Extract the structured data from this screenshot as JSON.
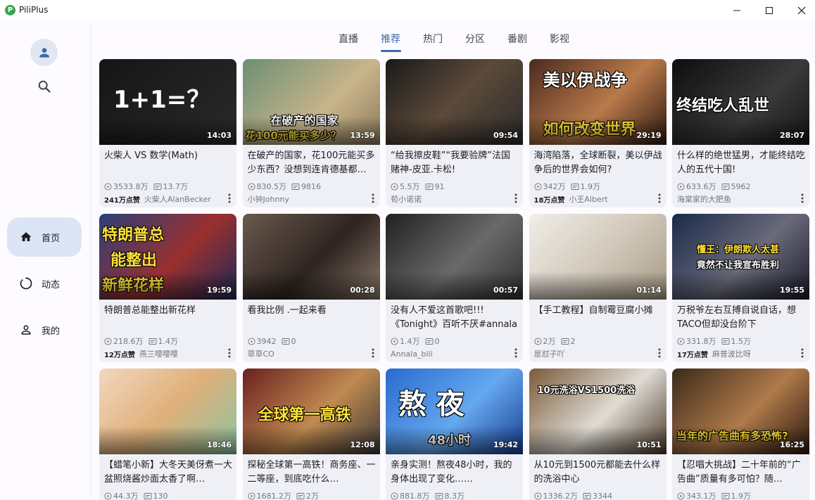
{
  "window": {
    "title": "PiliPlus",
    "logo_letter": "P"
  },
  "sidebar": {
    "items": [
      {
        "label": "首页",
        "icon": "home-icon",
        "active": true
      },
      {
        "label": "动态",
        "icon": "dynamic-icon",
        "active": false
      },
      {
        "label": "我的",
        "icon": "person-icon",
        "active": false
      }
    ]
  },
  "tabs": [
    {
      "label": "直播",
      "active": false
    },
    {
      "label": "推荐",
      "active": true
    },
    {
      "label": "热门",
      "active": false
    },
    {
      "label": "分区",
      "active": false
    },
    {
      "label": "番剧",
      "active": false
    },
    {
      "label": "影视",
      "active": false
    }
  ],
  "colors": {
    "accent": "#3a6ab0",
    "card_bg": "#eff0f6",
    "active_nav": "#dce5f5"
  },
  "videos": [
    {
      "title": "火柴人 VS 数学(Math)",
      "duration": "14:03",
      "views": "3533.8万",
      "danmaku": "13.7万",
      "likes": "241万点赞",
      "author": "火柴人AlanBecker",
      "overlay": "1+1=？"
    },
    {
      "title": "在破产的国家，花100元能买多少东西？没想到连肯德基都…",
      "duration": "13:59",
      "views": "830.5万",
      "danmaku": "9816",
      "likes": "",
      "author": "小钟Johnny",
      "overlay": "在破产的国家|花100元能买多少？"
    },
    {
      "title": "“给我擦皮鞋”“我要验牌”法国赌神-皮亚.卡松!",
      "duration": "09:54",
      "views": "5.5万",
      "danmaku": "91",
      "likes": "",
      "author": "荀小诺诺",
      "overlay": ""
    },
    {
      "title": "海湾陷落，全球断裂，美以伊战争后的世界会如何?",
      "duration": "29:19",
      "views": "342万",
      "danmaku": "1.9万",
      "likes": "18万点赞",
      "author": "小王Albert",
      "overlay": "美以伊战争|如何改变世界"
    },
    {
      "title": "什么样的绝世猛男，才能终结吃人的五代十国!",
      "duration": "28:07",
      "views": "633.6万",
      "danmaku": "5962",
      "likes": "",
      "author": "海棠家的大肥鱼",
      "overlay": "终结吃人乱世"
    },
    {
      "title": "特朗普总能整出新花样",
      "duration": "19:59",
      "views": "218.6万",
      "danmaku": "1.4万",
      "likes": "12万点赞",
      "author": "燕三嘤嘤嘤",
      "overlay": "特朗普总|能整出|新鲜花样"
    },
    {
      "title": "看我比例 .一起来看",
      "duration": "00:28",
      "views": "3942",
      "danmaku": "0",
      "likes": "",
      "author": "草草CO",
      "overlay": ""
    },
    {
      "title": "没有人不爱这首歌吧!!!《Tonight》百听不厌#annala",
      "duration": "00:57",
      "views": "1.4万",
      "danmaku": "0",
      "likes": "",
      "author": "Annala_bili",
      "overlay": ""
    },
    {
      "title": "【手工教程】自制霉豆腐小摊",
      "duration": "01:14",
      "views": "2万",
      "danmaku": "2",
      "likes": "",
      "author": "是怼子吖",
      "overlay": ""
    },
    {
      "title": "万税爷左右互搏自说自话，想TACO但却没台阶下",
      "duration": "19:55",
      "views": "331.8万",
      "danmaku": "1.5万",
      "likes": "17万点赞",
      "author": "麻普波比呀",
      "overlay": "懂王：伊朗欺人太甚|竟然不让我宣布胜利"
    },
    {
      "title": "【蜡笔小新】大冬天美伢煮一大盆照烧酱炒面太香了啊…",
      "duration": "18:46",
      "views": "44.3万",
      "danmaku": "130",
      "likes": "",
      "author": "",
      "overlay": ""
    },
    {
      "title": "探秘全球第一高铁！商务座、一二等座，到底吃什么…",
      "duration": "12:08",
      "views": "1681.2万",
      "danmaku": "2万",
      "likes": "",
      "author": "",
      "overlay": "全球第一高铁"
    },
    {
      "title": "亲身实测！熬夜48小时，我的身体出现了变化……",
      "duration": "19:42",
      "views": "881.8万",
      "danmaku": "8.3万",
      "likes": "",
      "author": "",
      "overlay": "熬   夜|48小时"
    },
    {
      "title": "从10元到1500元都能去什么样的洗浴中心",
      "duration": "10:51",
      "views": "1336.2万",
      "danmaku": "3344",
      "likes": "",
      "author": "",
      "overlay": "10元洗浴VS1500洗浴"
    },
    {
      "title": "【忍唱大挑战】二十年前的“广告曲”质量有多可怕？随…",
      "duration": "16:25",
      "views": "343.1万",
      "danmaku": "1.9万",
      "likes": "",
      "author": "",
      "overlay": "当年的广告曲有多恐怖?"
    }
  ]
}
